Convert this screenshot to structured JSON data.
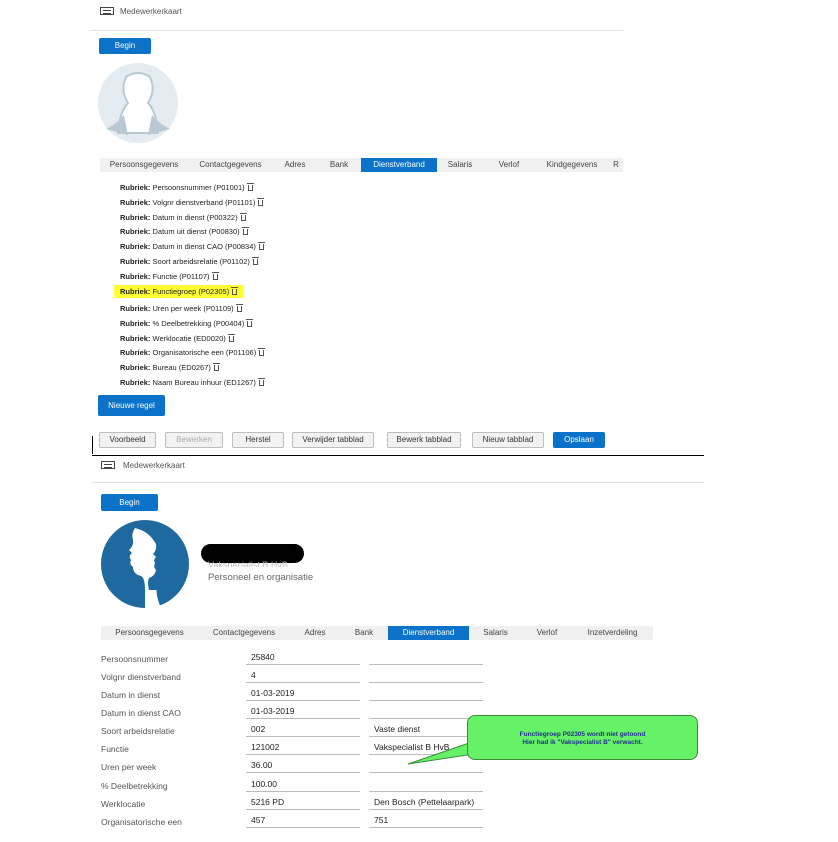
{
  "top": {
    "header_title": "Medewerkerkaart",
    "begin_label": "Begin",
    "tabs": [
      "Persoonsgegevens",
      "Contactgegevens",
      "Adres",
      "Bank",
      "Dienstverband",
      "Salaris",
      "Verlof",
      "Kindgegevens",
      "R"
    ],
    "active_tab": "Dienstverband",
    "rubriek_prefix": "Rubriek:",
    "rubrieken": [
      "Persoonsnummer (P01001)",
      "Volgnr dienstverband (P01101)",
      "Datum in dienst (P00322)",
      "Datum uit dienst (P00830)",
      "Datum in dienst CAO (P00834)",
      "Soort arbeidsrelatie (P01102)",
      "Functie (P01107)",
      "Functiegroep (P02305)",
      "Uren per week (P01109)",
      "% Deelbetrekking (P00404)",
      "Werklocatie (ED0020)",
      "Organisatorische een (P01106)",
      "Bureau (ED0267)",
      "Naam Bureau inhuur (ED1267)"
    ],
    "highlight_color": "#ffff33",
    "new_row_label": "Nieuwe regel",
    "toolbar": {
      "voorbeeld": "Voorbeeld",
      "bewerken": "Bewerken",
      "herstel": "Herstel",
      "verwijder": "Verwijder tabblad",
      "bewerk": "Bewerk tabblad",
      "nieuw": "Nieuw tabblad",
      "opslaan": "Opslaan"
    }
  },
  "bottom": {
    "header_title": "Medewerkerkaart",
    "begin_label": "Begin",
    "function_name": "Vakspecialist B HvB",
    "department": "Personeel en organisatie",
    "tabs": [
      "Persoonsgegevens",
      "Contactgegevens",
      "Adres",
      "Bank",
      "Dienstverband",
      "Salaris",
      "Verlof",
      "Inzetverdeling"
    ],
    "active_tab": "Dienstverband",
    "fields": [
      {
        "label": "Persoonsnummer",
        "value": "25840",
        "extra": ""
      },
      {
        "label": "Volgnr dienstverband",
        "value": "4",
        "extra": ""
      },
      {
        "label": "Datum in dienst",
        "value": "01-03-2019",
        "extra": ""
      },
      {
        "label": "Datum in dienst CAO",
        "value": "01-03-2019",
        "extra": ""
      },
      {
        "label": "Soort arbeidsrelatie",
        "value": "002",
        "extra": "Vaste dienst"
      },
      {
        "label": "Functie",
        "value": "121002",
        "extra": "Vakspecialist B HvB"
      },
      {
        "label": "Uren per week",
        "value": "36.00",
        "extra": ""
      },
      {
        "label": "% Deelbetrekking",
        "value": "100.00",
        "extra": ""
      },
      {
        "label": "Werklocatie",
        "value": "5216 PD",
        "extra": "Den Bosch (Pettelaarpark)"
      },
      {
        "label": "Organisatorische een",
        "value": "457",
        "extra": "751"
      }
    ],
    "callout_line1": "Functiegroep P02305 wordt niet getoond",
    "callout_line2": "Hier had ik \"Vakspecialist B\" verwacht.",
    "accent_color": "#0a72c8",
    "avatar_color": "#1e6aa0"
  }
}
